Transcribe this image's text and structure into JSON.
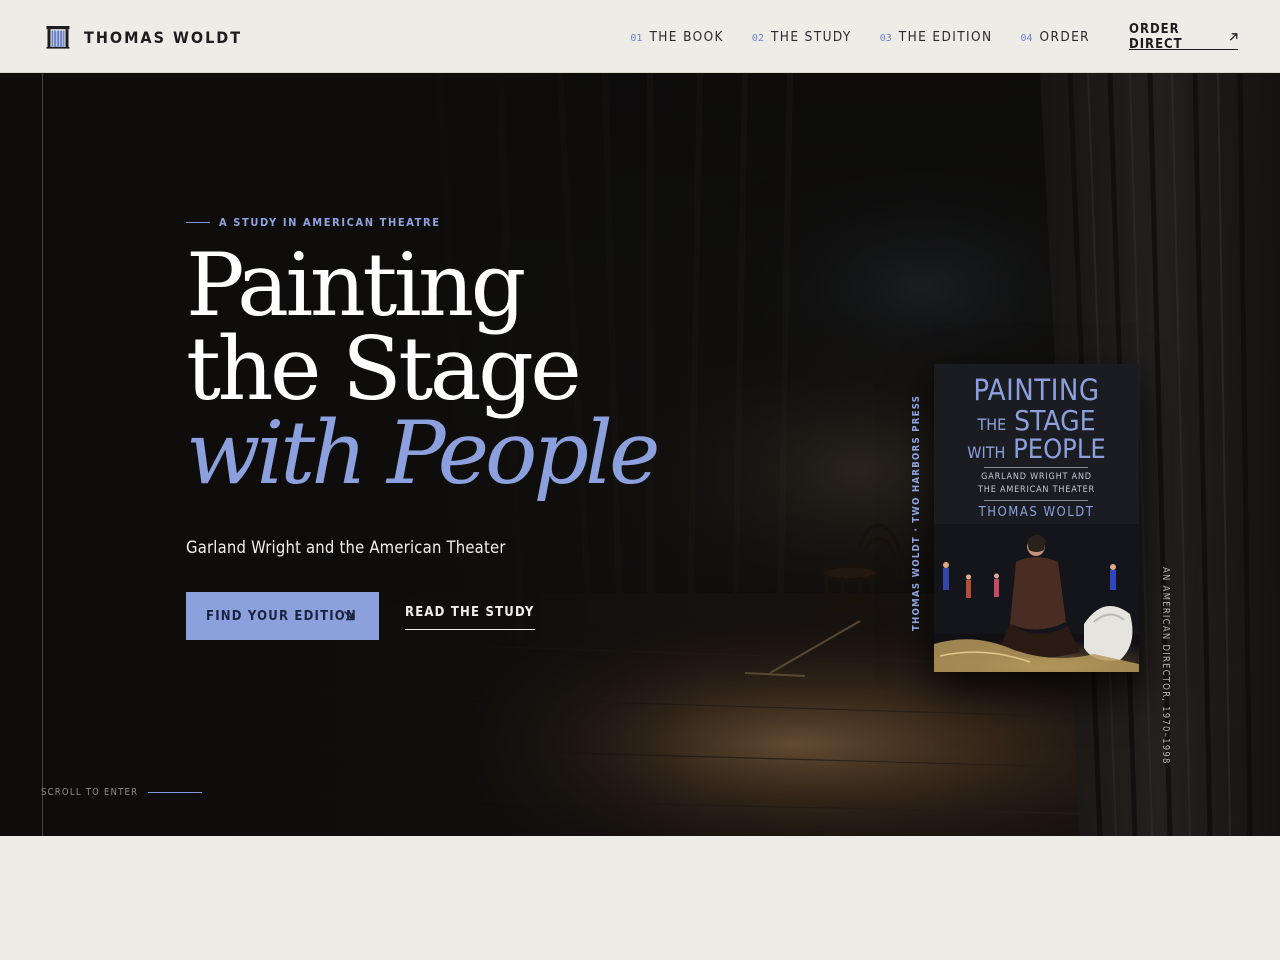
{
  "header": {
    "brand_name": "THOMAS WOLDT",
    "nav": [
      {
        "num": "01",
        "label": "THE BOOK"
      },
      {
        "num": "02",
        "label": "THE STUDY"
      },
      {
        "num": "03",
        "label": "THE EDITION"
      },
      {
        "num": "04",
        "label": "ORDER"
      }
    ],
    "order_direct": "ORDER DIRECT"
  },
  "hero": {
    "eyebrow": "A STUDY IN AMERICAN THEATRE",
    "title_line1": "Painting",
    "title_line2": "the Stage",
    "title_line3": "with People",
    "subtitle": "Garland Wright and the American Theater",
    "cta_primary": "FIND YOUR EDITION",
    "cta_secondary": "READ THE STUDY",
    "scroll_cue": "SCROLL TO ENTER"
  },
  "book": {
    "title_word1": "PAINTING",
    "title_the": "THE",
    "title_word2": "STAGE",
    "title_with": "WITH",
    "title_word3": "PEOPLE",
    "subtitle_line1": "GARLAND WRIGHT AND",
    "subtitle_line2": "THE AMERICAN THEATER",
    "author": "THOMAS WOLDT",
    "spine_left": "THOMAS WOLDT · TWO HARBORS PRESS",
    "spine_right": "AN AMERICAN DIRECTOR, 1970–1998"
  },
  "colors": {
    "accent": "#8ba0dd",
    "background": "#eeece7",
    "hero_dark": "#0e0d0c",
    "text_dark": "#1d1d1f"
  },
  "icons": {
    "brand": "theatre-proscenium-icon",
    "order_direct": "arrow-up-right-icon",
    "cta_primary": "arrow-down-right-icon"
  }
}
